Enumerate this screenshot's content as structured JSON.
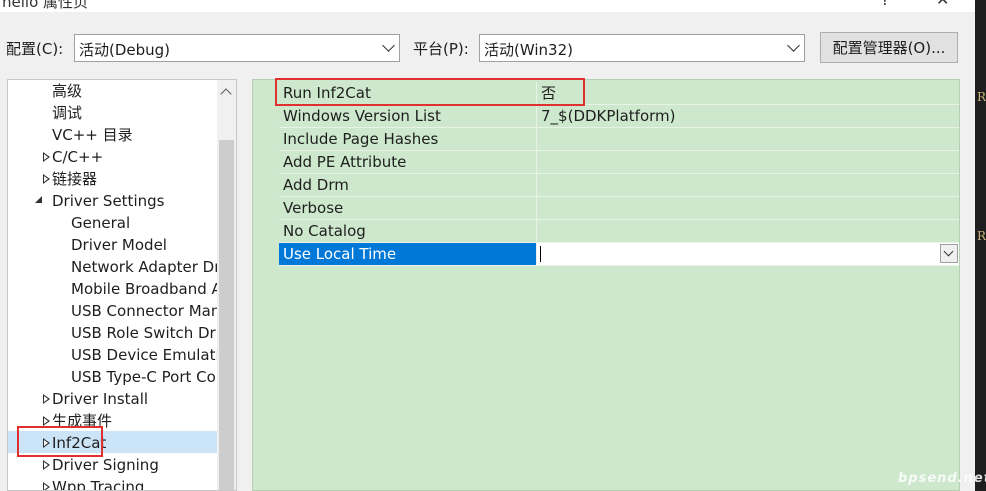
{
  "window": {
    "title": "hello 属性页",
    "help_glyph": "?",
    "close_glyph": "✕"
  },
  "toolbar": {
    "config_label": "配置(C):",
    "config_value": "活动(Debug)",
    "platform_label": "平台(P):",
    "platform_value": "活动(Win32)",
    "config_manager_label": "配置管理器(O)..."
  },
  "tree": {
    "items": [
      {
        "label": "高级"
      },
      {
        "label": "调试"
      },
      {
        "label": "VC++ 目录"
      },
      {
        "label": "C/C++"
      },
      {
        "label": "链接器"
      },
      {
        "label": "Driver Settings"
      },
      {
        "label": "General"
      },
      {
        "label": "Driver Model"
      },
      {
        "label": "Network Adapter Driver"
      },
      {
        "label": "Mobile Broadband Adapter"
      },
      {
        "label": "USB Connector Manager"
      },
      {
        "label": "USB Role Switch Driver"
      },
      {
        "label": "USB Device Emulation"
      },
      {
        "label": "USB Type-C Port Controller"
      },
      {
        "label": "Driver Install"
      },
      {
        "label": "生成事件"
      },
      {
        "label": "Inf2Cat"
      },
      {
        "label": "Driver Signing"
      },
      {
        "label": "Wpp Tracing"
      }
    ],
    "selected": "Inf2Cat"
  },
  "grid": {
    "rows": [
      {
        "name": "Run Inf2Cat",
        "value": "否"
      },
      {
        "name": "Windows Version List",
        "value": "7_$(DDKPlatform)"
      },
      {
        "name": "Include Page Hashes",
        "value": ""
      },
      {
        "name": "Add PE Attribute",
        "value": ""
      },
      {
        "name": "Add Drm",
        "value": ""
      },
      {
        "name": "Verbose",
        "value": ""
      },
      {
        "name": "No Catalog",
        "value": ""
      },
      {
        "name": "Use Local Time",
        "value": ""
      }
    ],
    "selected": "Use Local Time"
  },
  "side": {
    "letter1": "R",
    "letter2": "R"
  },
  "watermark": "bpsend.net"
}
